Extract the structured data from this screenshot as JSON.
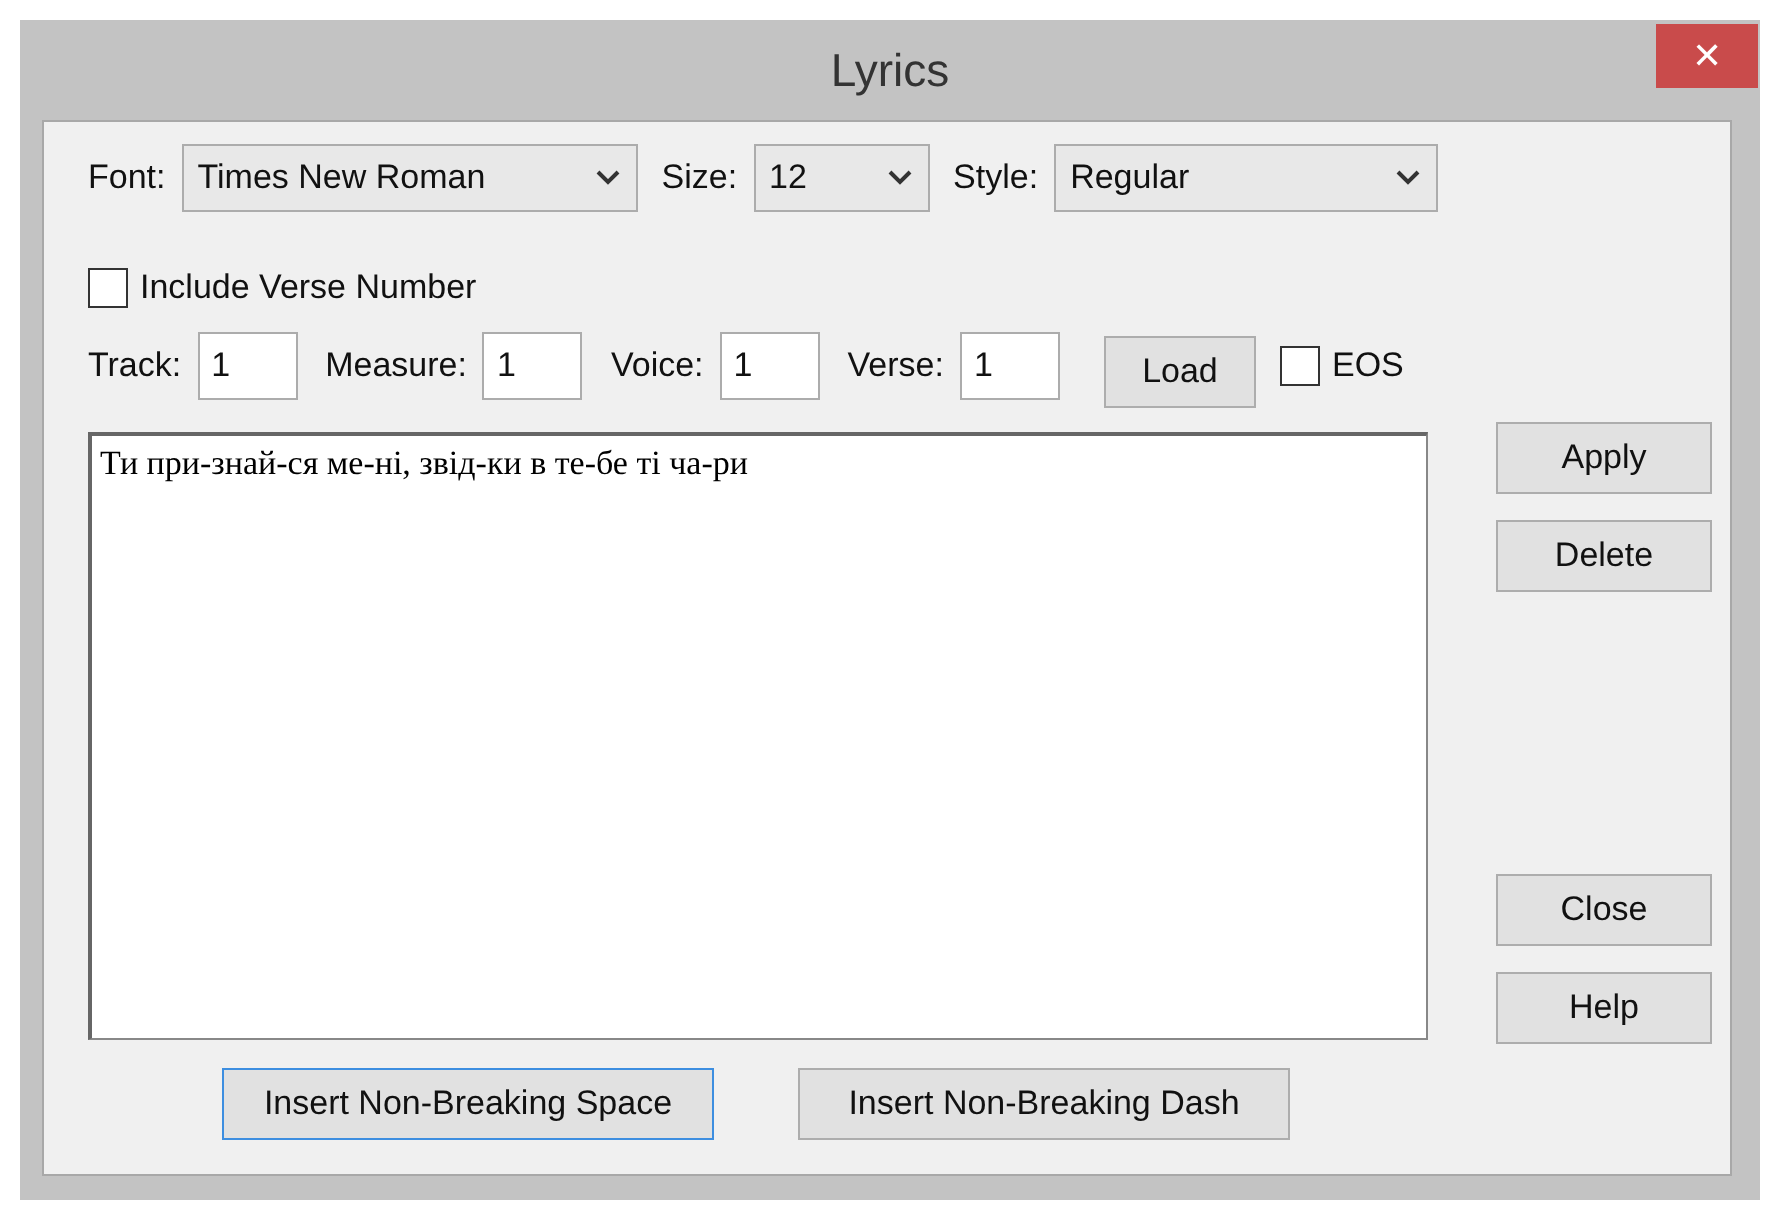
{
  "window": {
    "title": "Lyrics",
    "close": "✕"
  },
  "format": [
    {
      "label": "Font:",
      "value": "Times New Roman"
    },
    {
      "label": "Size:",
      "value": "12"
    },
    {
      "label": "Style:",
      "value": "Regular"
    }
  ],
  "include_verse_number": {
    "label": "Include Verse Number",
    "checked": false
  },
  "position": [
    {
      "label": "Track:",
      "value": "1"
    },
    {
      "label": "Measure:",
      "value": "1"
    },
    {
      "label": "Voice:",
      "value": "1"
    },
    {
      "label": "Verse:",
      "value": "1"
    }
  ],
  "load_button": "Load",
  "eos": {
    "label": "EOS",
    "checked": false
  },
  "lyrics": "Ти при-знай-ся ме-ні, звід-ки в те-бе ті ча-ри",
  "side_buttons": [
    [
      "Apply",
      "Delete"
    ],
    [
      "Close",
      "Help"
    ]
  ],
  "insert_buttons": [
    {
      "label": "Insert Non-Breaking Space",
      "focused": true
    },
    {
      "label": "Insert Non-Breaking Dash",
      "focused": false
    }
  ]
}
